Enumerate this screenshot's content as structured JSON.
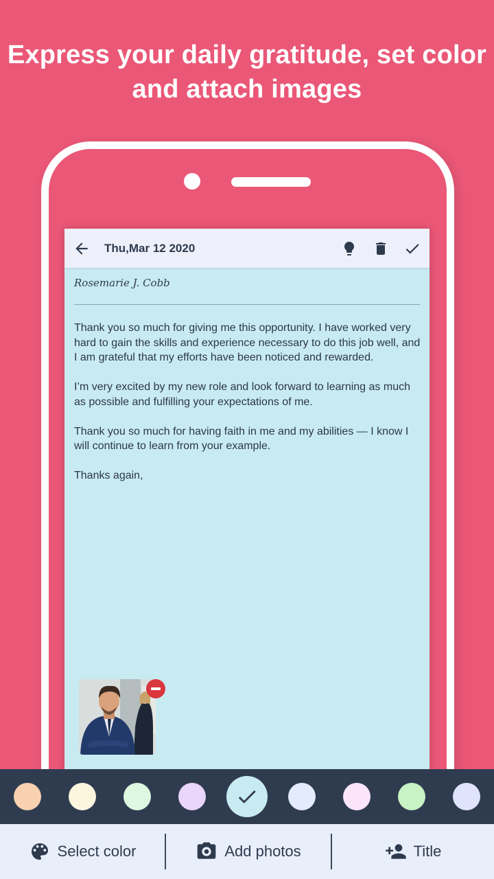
{
  "promo": {
    "headline_line1": "Express your daily gratitude, set color",
    "headline_line2": "and attach images"
  },
  "appbar": {
    "back_icon": "arrow-left-icon",
    "date": "Thu,Mar 12 2020",
    "actions": [
      {
        "icon": "lightbulb-icon",
        "label": "Tip"
      },
      {
        "icon": "trash-icon",
        "label": "Delete"
      },
      {
        "icon": "check-icon",
        "label": "Save"
      }
    ]
  },
  "note": {
    "author": "Rosemarie J. Cobb",
    "paragraphs": [
      "Thank you so much for giving me this opportunity. I have worked very hard to gain the skills and experience necessary to do this job well, and I am grateful that my efforts have been noticed and rewarded.",
      "I’m very excited by my new role and look forward to learning as much as possible and fulfilling your expectations of me.",
      "Thank you so much for having faith in me and my abilities — I know I will continue to learn from your example.",
      "Thanks again,"
    ],
    "background_color": "#c8ebf2",
    "attachment": {
      "description": "Photo of smiling man in suit with arms crossed",
      "remove_icon": "minus-circle-icon"
    }
  },
  "color_swatches": [
    {
      "color": "#f8d2b0",
      "selected": false
    },
    {
      "color": "#fdf6df",
      "selected": false
    },
    {
      "color": "#ddf7e0",
      "selected": false
    },
    {
      "color": "#ead6fa",
      "selected": false
    },
    {
      "color": "#c8ebf2",
      "selected": true
    },
    {
      "color": "#e4ebfc",
      "selected": false
    },
    {
      "color": "#fbe5fb",
      "selected": false
    },
    {
      "color": "#c8f3c4",
      "selected": false
    },
    {
      "color": "#dfe4fc",
      "selected": false
    }
  ],
  "bottom_bar": {
    "select_color": {
      "label": "Select color",
      "icon": "palette-icon"
    },
    "add_photos": {
      "label": "Add photos",
      "icon": "camera-icon"
    },
    "title": {
      "label": "Title",
      "icon": "person-add-icon"
    }
  },
  "colors": {
    "brand_pink": "#ea5777",
    "dark_navy": "#2f3c4f",
    "appbar_bg": "#edf0fb",
    "remove_red": "#d9363e"
  }
}
